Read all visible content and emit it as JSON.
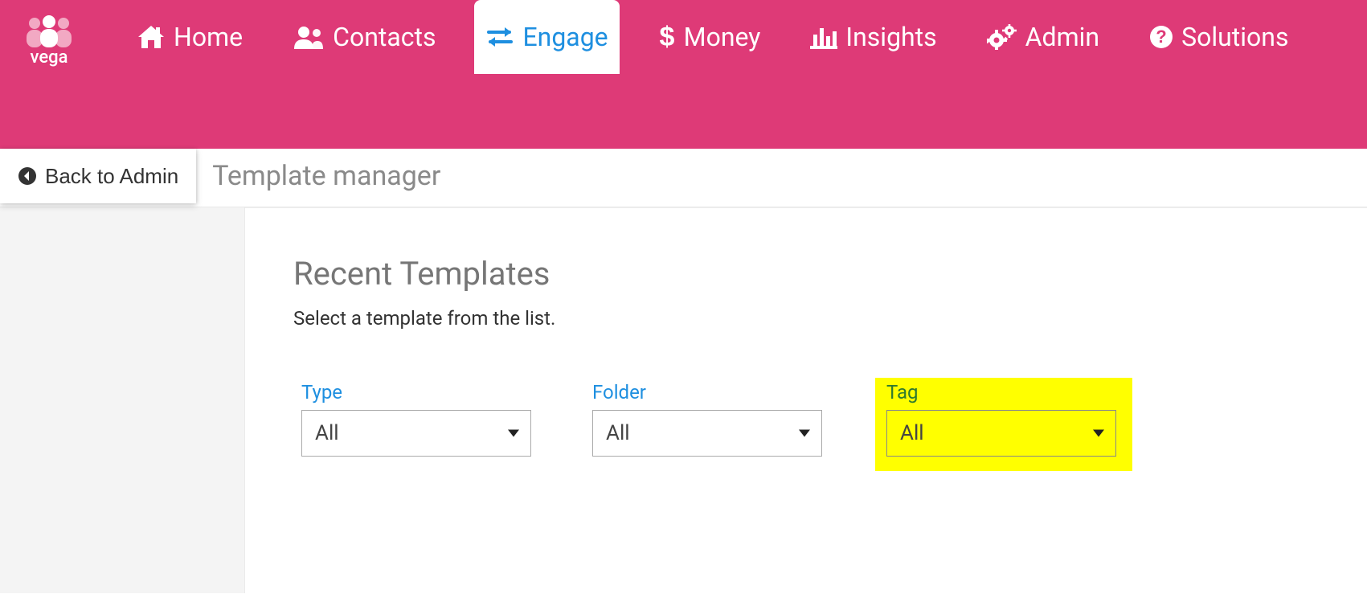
{
  "brand": {
    "name": "vega"
  },
  "nav": {
    "items": [
      {
        "id": "home",
        "label": "Home",
        "icon": "home-icon"
      },
      {
        "id": "contacts",
        "label": "Contacts",
        "icon": "users-icon"
      },
      {
        "id": "engage",
        "label": "Engage",
        "icon": "exchange-icon",
        "active": true
      },
      {
        "id": "money",
        "label": "Money",
        "icon": "dollar-icon"
      },
      {
        "id": "insights",
        "label": "Insights",
        "icon": "bar-chart-icon"
      },
      {
        "id": "admin",
        "label": "Admin",
        "icon": "gears-icon"
      },
      {
        "id": "solutions",
        "label": "Solutions",
        "icon": "question-circle-icon"
      }
    ]
  },
  "subheader": {
    "back_label": "Back to Admin",
    "title": "Template manager"
  },
  "main": {
    "heading": "Recent Templates",
    "subtext": "Select a template from the list.",
    "filters": {
      "type": {
        "label": "Type",
        "value": "All"
      },
      "folder": {
        "label": "Folder",
        "value": "All"
      },
      "tag": {
        "label": "Tag",
        "value": "All",
        "highlighted": true
      }
    }
  },
  "colors": {
    "brand_pink": "#de3a77",
    "accent_blue": "#1e8fe0",
    "highlight_yellow": "#ffff00"
  }
}
